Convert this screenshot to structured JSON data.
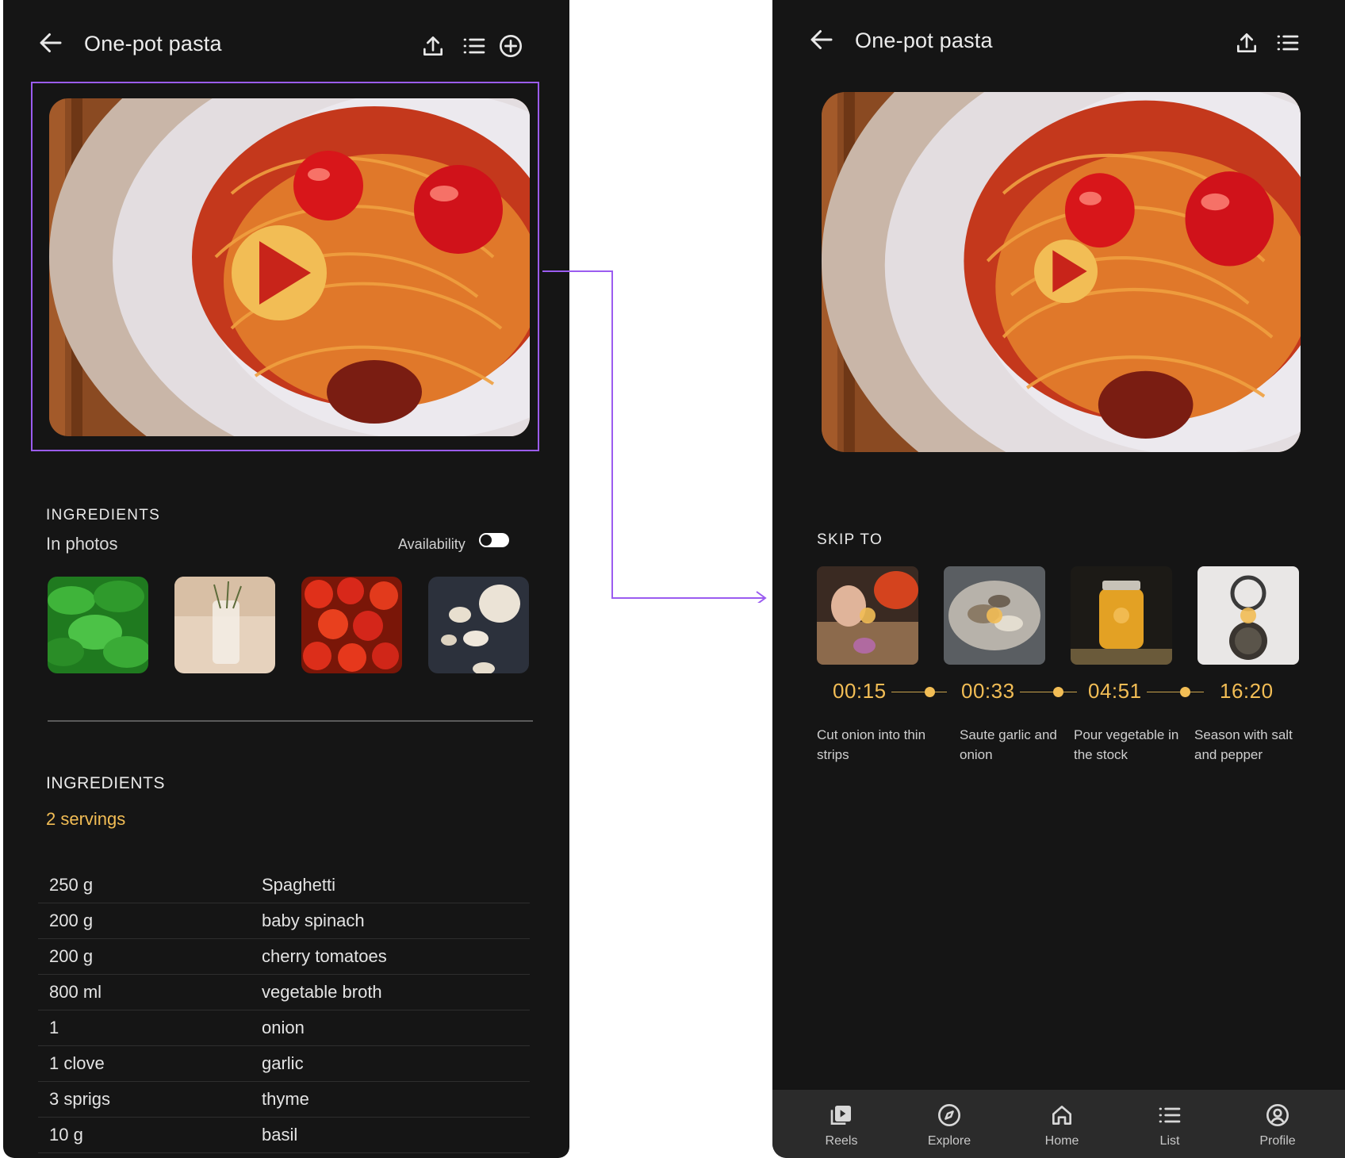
{
  "left_screen": {
    "title": "One-pot pasta",
    "icons": [
      "arrow-left-icon",
      "upload-icon",
      "list-icon",
      "add-circle-icon"
    ],
    "section1_heading": "INGREDIENTS",
    "photos_label": "In photos",
    "availability_label": "Availability",
    "availability_on": false,
    "ingredient_photos": [
      "spinach",
      "thyme",
      "cherry tomatoes",
      "garlic"
    ],
    "section2_heading": "INGREDIENTS",
    "servings": "2 servings",
    "ingredients": [
      {
        "qty": "250 g",
        "name": "Spaghetti"
      },
      {
        "qty": "200 g",
        "name": "baby spinach"
      },
      {
        "qty": "200 g",
        "name": "cherry tomatoes"
      },
      {
        "qty": "800 ml",
        "name": "vegetable broth"
      },
      {
        "qty": "1",
        "name": "onion"
      },
      {
        "qty": "1 clove",
        "name": "garlic"
      },
      {
        "qty": "3 sprigs",
        "name": "thyme"
      },
      {
        "qty": "10 g",
        "name": "basil"
      }
    ]
  },
  "right_screen": {
    "title": "One-pot pasta",
    "icons": [
      "arrow-left-icon",
      "upload-icon",
      "list-icon"
    ],
    "skip_heading": "SKIP TO",
    "steps": [
      {
        "time": "00:15",
        "desc": "Cut onion into thin strips"
      },
      {
        "time": "00:33",
        "desc": "Saute garlic and onion"
      },
      {
        "time": "04:51",
        "desc": "Pour vegetable in the stock"
      },
      {
        "time": "16:20",
        "desc": "Season with salt and pepper"
      }
    ],
    "nav": [
      {
        "label": "Reels",
        "icon": "reels-icon"
      },
      {
        "label": "Explore",
        "icon": "compass-icon"
      },
      {
        "label": "Home",
        "icon": "home-icon"
      },
      {
        "label": "List",
        "icon": "list-icon"
      },
      {
        "label": "Profile",
        "icon": "profile-icon"
      }
    ]
  },
  "colors": {
    "background": "#151515",
    "accent": "#f2bd55",
    "highlight": "#9b5cf0",
    "nav_background": "#2b2b2b"
  }
}
